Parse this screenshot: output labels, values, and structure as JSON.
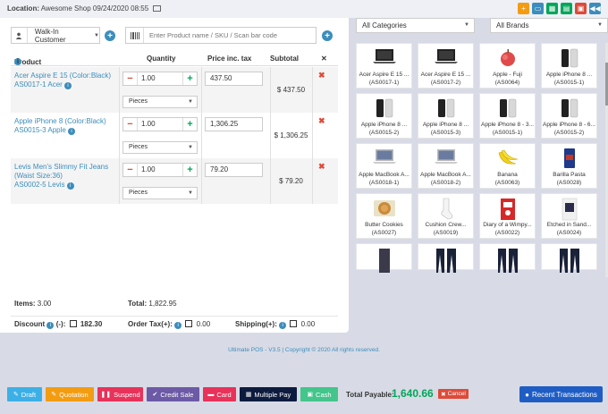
{
  "header": {
    "location_label": "Location:",
    "location_value": "Awesome Shop 09/24/2020 08:55",
    "buttons": [
      {
        "name": "add-expense",
        "color": "#f39c12",
        "icon": "plus-circle-icon"
      },
      {
        "name": "register-details",
        "color": "#3c8dbc",
        "icon": "window-icon"
      },
      {
        "name": "calculator",
        "color": "#00a65a",
        "icon": "calculator-icon"
      },
      {
        "name": "close-register",
        "color": "#00a65a",
        "icon": "briefcase-icon"
      },
      {
        "name": "fullscreen",
        "color": "#dd4b39",
        "icon": "window-close-icon"
      },
      {
        "name": "go-back",
        "color": "#3c8dbc",
        "icon": "backward-icon"
      }
    ]
  },
  "customer": {
    "selected": "Walk-In Customer"
  },
  "search": {
    "placeholder": "Enter Product name / SKU / Scan bar code"
  },
  "cart": {
    "headers": {
      "product": "Product",
      "quantity": "Quantity",
      "price": "Price inc. tax",
      "subtotal": "Subtotal",
      "remove": "✕"
    },
    "rows": [
      {
        "name": "Acer Aspire E 15 (Color:Black)",
        "sku": "AS0017-1 Acer",
        "qty": "1.00",
        "unit": "Pieces",
        "price": "437.50",
        "subtotal": "$ 437.50"
      },
      {
        "name": "Apple iPhone 8 (Color:Black)",
        "sku": "AS0015-3 Apple",
        "qty": "1.00",
        "unit": "Pieces",
        "price": "1,306.25",
        "subtotal": "$ 1,306.25"
      },
      {
        "name": "Levis Men's Slimmy Fit Jeans (Waist Size:36)",
        "sku": "AS0002-5 Levis",
        "qty": "1.00",
        "unit": "Pieces",
        "price": "79.20",
        "subtotal": "$ 79.20"
      }
    ]
  },
  "totals": {
    "items_label": "Items:",
    "items_value": "3.00",
    "total_label": "Total:",
    "total_value": "1,822.95",
    "discount_label": "Discount",
    "discount_sign": "(-):",
    "discount_value": "182.30",
    "order_tax_label": "Order Tax(+):",
    "order_tax_value": "0.00",
    "shipping_label": "Shipping(+):",
    "shipping_value": "0.00"
  },
  "filters": {
    "category": "All Categories",
    "brand": "All Brands"
  },
  "products": [
    {
      "name": "Acer Aspire E 15 ...",
      "sku": "(AS0017-1)",
      "thumb": "laptop"
    },
    {
      "name": "Acer Aspire E 15 ...",
      "sku": "(AS0017-2)",
      "thumb": "laptop"
    },
    {
      "name": "Apple - Fuji",
      "sku": "(AS0064)",
      "thumb": "apple"
    },
    {
      "name": "Apple iPhone 8 ...",
      "sku": "(AS0015-1)",
      "thumb": "phone"
    },
    {
      "name": "Apple iPhone 8 ...",
      "sku": "(AS0015-2)",
      "thumb": "phone"
    },
    {
      "name": "Apple iPhone 8 ...",
      "sku": "(AS0015-3)",
      "thumb": "phone"
    },
    {
      "name": "Apple iPhone 8 - 3...",
      "sku": "(AS0015-1)",
      "thumb": "phone"
    },
    {
      "name": "Apple iPhone 8 - 6...",
      "sku": "(AS0015-2)",
      "thumb": "phone"
    },
    {
      "name": "Apple MacBook A...",
      "sku": "(AS0018-1)",
      "thumb": "macbook"
    },
    {
      "name": "Apple MacBook A...",
      "sku": "(AS0018-2)",
      "thumb": "macbook"
    },
    {
      "name": "Banana",
      "sku": "(AS0063)",
      "thumb": "banana"
    },
    {
      "name": "Barilla Pasta",
      "sku": "(AS0028)",
      "thumb": "pasta"
    },
    {
      "name": "Butter Cookies",
      "sku": "(AS0027)",
      "thumb": "cookies"
    },
    {
      "name": "Cushion Crew...",
      "sku": "(AS0019)",
      "thumb": "sock"
    },
    {
      "name": "Diary of a Wimpy...",
      "sku": "(AS0022)",
      "thumb": "book"
    },
    {
      "name": "Etched in Sand...",
      "sku": "(AS0024)",
      "thumb": "book2"
    },
    {
      "name": "",
      "sku": "",
      "thumb": "shirt"
    },
    {
      "name": "",
      "sku": "",
      "thumb": "jeans"
    },
    {
      "name": "",
      "sku": "",
      "thumb": "jeans"
    },
    {
      "name": "",
      "sku": "",
      "thumb": "jeans"
    }
  ],
  "footer": {
    "note": "Ultimate POS - V3.5 | Copyright © 2020 All rights reserved."
  },
  "actions": {
    "draft": "Draft",
    "quotation": "Quotation",
    "suspend": "Suspend",
    "credit_sale": "Credit Sale",
    "card": "Card",
    "multiple_pay": "Multiple Pay",
    "cash": "Cash",
    "total_payable_label": "Total Payable:",
    "total_payable_value": "1,640.66",
    "cancel": "Cancel",
    "recent": "Recent Transactions"
  },
  "colors": {
    "primary": "#3c8dbc",
    "success": "#00a65a",
    "danger": "#dd4b39",
    "warning": "#f39c12"
  }
}
